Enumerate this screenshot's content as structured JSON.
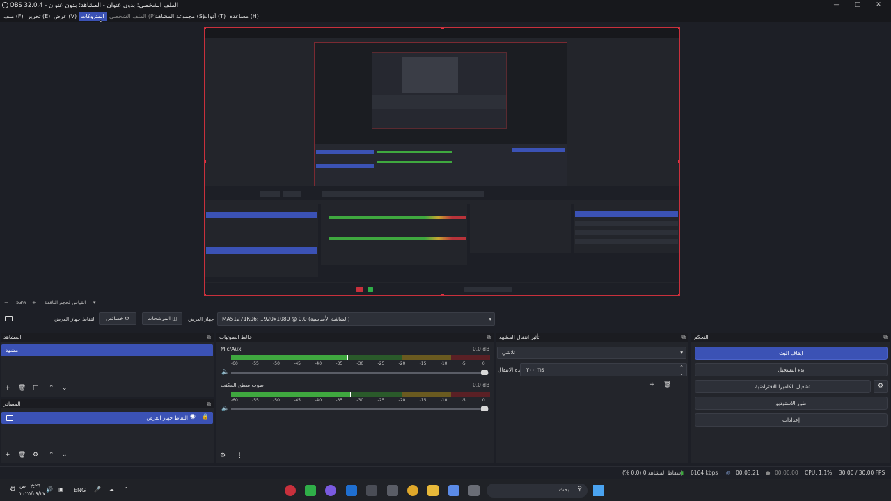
{
  "window": {
    "title": "OBS 32.0.4 - الملف الشخصي: بدون عنوان - المشاهد: بدون عنوان"
  },
  "menu": [
    {
      "label": "ملف (F)"
    },
    {
      "label": "تحرير (E)"
    },
    {
      "label": "عرض (V)"
    },
    {
      "label": "المتروكات"
    },
    {
      "label": "الملف الشخصي (P)"
    },
    {
      "label": "مجموعة المشاهد (S)"
    },
    {
      "label": "أدوات (T)"
    },
    {
      "label": "مساعدة (H)"
    }
  ],
  "zoom": {
    "value": "53%",
    "scale_label": "القياس لحجم النافذة"
  },
  "source_toolbar": {
    "source_name": "التقاط جهاز العرض",
    "properties": "خصائص",
    "filters": "المرشحات",
    "display_label": "جهاز العرض",
    "display_value": "MA51271K06: 1920x1080 @ 0,0 (الشاشة الأساسية)"
  },
  "scenes": {
    "title": "المشاهد",
    "items": [
      "مشهد"
    ]
  },
  "sources": {
    "title": "المصادر",
    "items": [
      "التقاط جهاز العرض"
    ]
  },
  "mixer": {
    "title": "خالط الصوتيات",
    "channels": [
      {
        "name": "Mic/Aux",
        "db": "0.0 dB",
        "level": 0.45
      },
      {
        "name": "صوت سطح المكتب",
        "db": "0.0 dB",
        "level": 0.46
      }
    ],
    "scale": [
      "-60",
      "-55",
      "-50",
      "-45",
      "-40",
      "-35",
      "-30",
      "-25",
      "-20",
      "-15",
      "-10",
      "-5",
      "0"
    ]
  },
  "transitions": {
    "title": "تأثير انتقال المشهد",
    "type": "تلاشي",
    "duration_label": "مدة الانتقال",
    "duration": "٣٠٠ ms"
  },
  "controls": {
    "title": "التحكم",
    "buttons": [
      "ايقاف البث",
      "بدء التسجيل",
      "تشغيل الكاميرا الافتراضية",
      "طور الاستوديو",
      "إعدادات"
    ]
  },
  "status": {
    "dropped": "إسقاط المشاهد 0 (0.0 %)",
    "bitrate": "6164 kbps",
    "stream_time": "00:03:21",
    "rec_time": "00:00:00",
    "cpu": "CPU: 1.1%",
    "fps": "30.00 / 30.00 FPS"
  },
  "taskbar": {
    "time": "٠٢:٢٦ ص",
    "date": "٢٠٢٥/٠٩/٢٧",
    "lang": "ENG",
    "search_placeholder": "بحث"
  },
  "colors": {
    "accent": "#3b52b5",
    "red_border": "#c8303c",
    "meter_green": "#3fa83f",
    "meter_yellow": "#c9a531",
    "meter_red": "#b8333a"
  }
}
